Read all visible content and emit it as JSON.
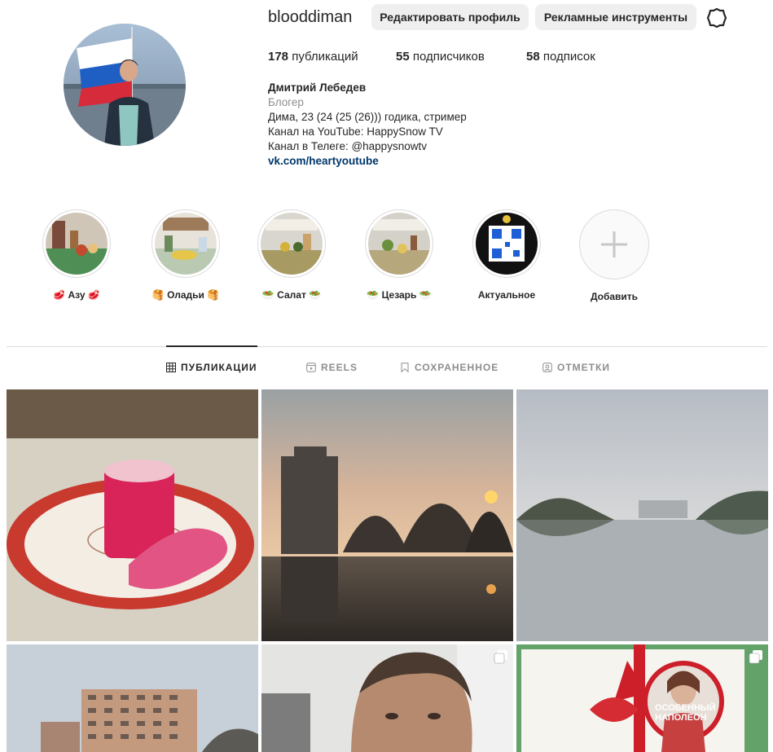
{
  "profile": {
    "username": "blooddiman",
    "edit_button": "Редактировать профиль",
    "ads_button": "Рекламные инструменты",
    "settings_icon": "settings-icon"
  },
  "stats": {
    "posts_count": "178",
    "posts_label": " публикаций",
    "followers_count": "55",
    "followers_label": " подписчиков",
    "following_count": "58",
    "following_label": " подписок"
  },
  "bio": {
    "name": "Дмитрий Лебедев",
    "category": "Блогер",
    "line1": "Дима, 23 (24 (25 (26))) годика, стример",
    "line2": "Канал на YouTube: HappySnow TV",
    "line3": "Канал в Телеге: @happysnowtv",
    "link": "vk.com/heartyoutube"
  },
  "highlights": [
    {
      "label": "🥩 Азу 🥩"
    },
    {
      "label": "🥞 Оладьи 🥞"
    },
    {
      "label": "🥗 Салат 🥗"
    },
    {
      "label": "🥗 Цезарь 🥗"
    },
    {
      "label": "Актуальное"
    },
    {
      "label": "Добавить"
    }
  ],
  "tabs": [
    {
      "label": "ПУБЛИКАЦИИ",
      "icon": "grid-icon"
    },
    {
      "label": "REELS",
      "icon": "reels-icon"
    },
    {
      "label": "СОХРАНЕННОЕ",
      "icon": "bookmark-icon"
    },
    {
      "label": "ОТМЕТКИ",
      "icon": "tagged-icon"
    }
  ],
  "post_tile_text": {
    "napoleon_title_1": "ОСОБЕННЫЙ",
    "napoleon_title_2": "НАПОЛЕОН"
  },
  "colors": {
    "link": "#00376b",
    "muted": "#8e8e8e",
    "button_bg": "#efefef"
  }
}
